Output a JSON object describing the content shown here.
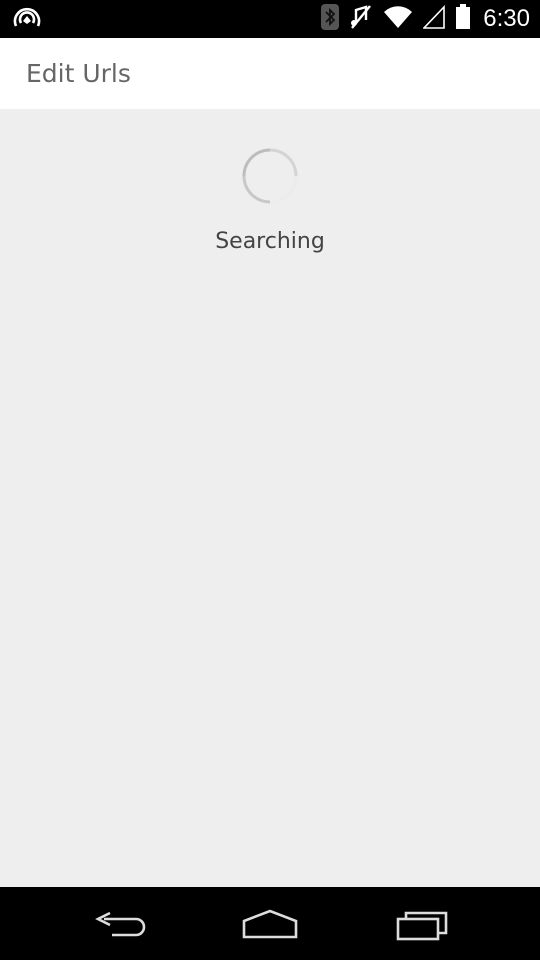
{
  "status_bar": {
    "time": "6:30",
    "icons": [
      "hotspot-icon",
      "bluetooth-icon",
      "mute-icon",
      "wifi-icon",
      "signal-icon",
      "battery-icon"
    ]
  },
  "app_bar": {
    "title": "Edit Urls"
  },
  "content": {
    "status_text": "Searching"
  },
  "nav_bar": {
    "icons": [
      "back-icon",
      "home-icon",
      "recent-apps-icon"
    ]
  }
}
